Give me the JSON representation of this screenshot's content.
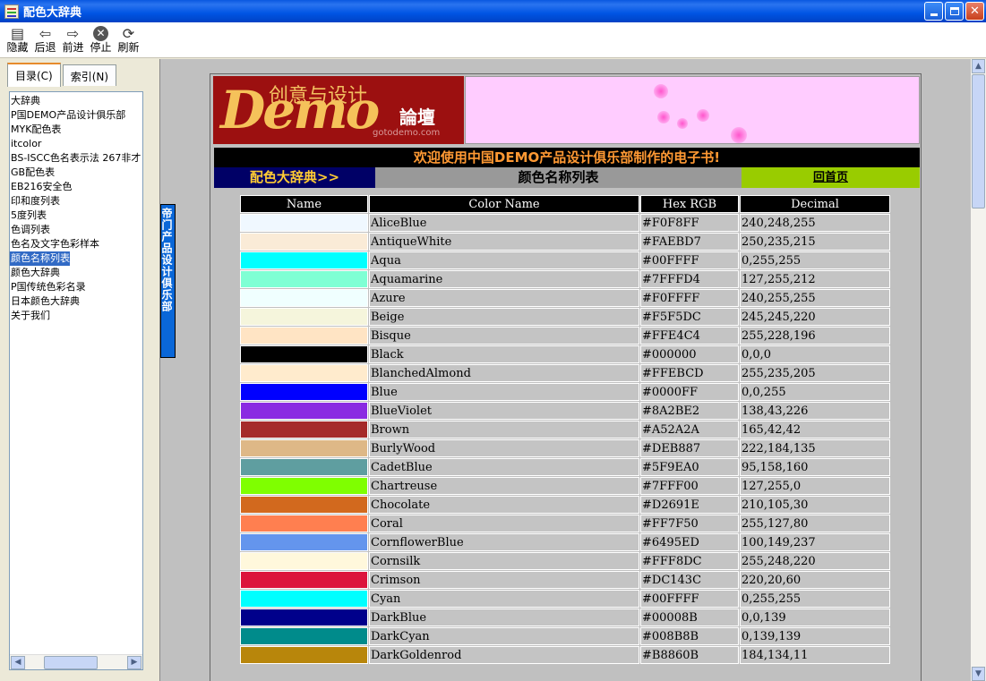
{
  "window": {
    "title": "配色大辞典",
    "icon": "help-book-icon"
  },
  "toolbar": {
    "buttons": [
      {
        "label": "隐藏",
        "icon": "hide-pane-icon"
      },
      {
        "label": "后退",
        "icon": "back-arrow-icon"
      },
      {
        "label": "前进",
        "icon": "forward-arrow-icon"
      },
      {
        "label": "停止",
        "icon": "stop-icon"
      },
      {
        "label": "刷新",
        "icon": "refresh-icon"
      }
    ]
  },
  "sidebar": {
    "tabs": [
      {
        "label": "目录(C)"
      },
      {
        "label": "索引(N)"
      }
    ],
    "items": [
      {
        "label": "大辞典"
      },
      {
        "label": "P国DEMO产品设计俱乐部"
      },
      {
        "label": "MYK配色表"
      },
      {
        "label": "itcolor"
      },
      {
        "label": "BS-ISCC色名表示法 267非才"
      },
      {
        "label": "GB配色表"
      },
      {
        "label": "EB216安全色"
      },
      {
        "label": "印和度列表"
      },
      {
        "label": "5度列表"
      },
      {
        "label": "色调列表"
      },
      {
        "label": "色名及文字色彩样本"
      },
      {
        "label": "颜色名称列表"
      },
      {
        "label": "颜色大辞典"
      },
      {
        "label": "P国传统色彩名录"
      },
      {
        "label": "日本颜色大辞典"
      },
      {
        "label": "关于我们"
      }
    ],
    "selected_index": 11
  },
  "content": {
    "side_label": "帝门产品设计俱乐部",
    "banner": {
      "title": "创意与设计",
      "subtitle": "論壇",
      "logo_text": "Demo",
      "url": "gotodemo.com"
    },
    "welcome": "欢迎使用中国DEMO产品设计俱乐部制作的电子书!",
    "nav": {
      "left": "配色大辞典>>",
      "middle": "颜色名称列表",
      "right": "回首页"
    },
    "table": {
      "headers": [
        "Name",
        "Color Name",
        "Hex RGB",
        "Decimal"
      ],
      "rows": [
        {
          "name": "AliceBlue",
          "hex": "#F0F8FF",
          "dec": "240,248,255",
          "color": "#F0F8FF"
        },
        {
          "name": "AntiqueWhite",
          "hex": "#FAEBD7",
          "dec": "250,235,215",
          "color": "#FAEBD7"
        },
        {
          "name": "Aqua",
          "hex": "#00FFFF",
          "dec": "0,255,255",
          "color": "#00FFFF"
        },
        {
          "name": "Aquamarine",
          "hex": "#7FFFD4",
          "dec": "127,255,212",
          "color": "#7FFFD4"
        },
        {
          "name": "Azure",
          "hex": "#F0FFFF",
          "dec": "240,255,255",
          "color": "#F0FFFF"
        },
        {
          "name": "Beige",
          "hex": "#F5F5DC",
          "dec": "245,245,220",
          "color": "#F5F5DC"
        },
        {
          "name": "Bisque",
          "hex": "#FFE4C4",
          "dec": "255,228,196",
          "color": "#FFE4C4"
        },
        {
          "name": "Black",
          "hex": "#000000",
          "dec": "0,0,0",
          "color": "#000000"
        },
        {
          "name": "BlanchedAlmond",
          "hex": "#FFEBCD",
          "dec": "255,235,205",
          "color": "#FFEBCD"
        },
        {
          "name": "Blue",
          "hex": "#0000FF",
          "dec": "0,0,255",
          "color": "#0000FF"
        },
        {
          "name": "BlueViolet",
          "hex": "#8A2BE2",
          "dec": "138,43,226",
          "color": "#8A2BE2"
        },
        {
          "name": "Brown",
          "hex": "#A52A2A",
          "dec": "165,42,42",
          "color": "#A52A2A"
        },
        {
          "name": "BurlyWood",
          "hex": "#DEB887",
          "dec": "222,184,135",
          "color": "#DEB887"
        },
        {
          "name": "CadetBlue",
          "hex": "#5F9EA0",
          "dec": "95,158,160",
          "color": "#5F9EA0"
        },
        {
          "name": "Chartreuse",
          "hex": "#7FFF00",
          "dec": "127,255,0",
          "color": "#7FFF00"
        },
        {
          "name": "Chocolate",
          "hex": "#D2691E",
          "dec": "210,105,30",
          "color": "#D2691E"
        },
        {
          "name": "Coral",
          "hex": "#FF7F50",
          "dec": "255,127,80",
          "color": "#FF7F50"
        },
        {
          "name": "CornflowerBlue",
          "hex": "#6495ED",
          "dec": "100,149,237",
          "color": "#6495ED"
        },
        {
          "name": "Cornsilk",
          "hex": "#FFF8DC",
          "dec": "255,248,220",
          "color": "#FFF8DC"
        },
        {
          "name": "Crimson",
          "hex": "#DC143C",
          "dec": "220,20,60",
          "color": "#DC143C"
        },
        {
          "name": "Cyan",
          "hex": "#00FFFF",
          "dec": "0,255,255",
          "color": "#00FFFF"
        },
        {
          "name": "DarkBlue",
          "hex": "#00008B",
          "dec": "0,0,139",
          "color": "#00008B"
        },
        {
          "name": "DarkCyan",
          "hex": "#008B8B",
          "dec": "0,139,139",
          "color": "#008B8B"
        },
        {
          "name": "DarkGoldenrod",
          "hex": "#B8860B",
          "dec": "184,134,11",
          "color": "#B8860B"
        }
      ]
    }
  }
}
